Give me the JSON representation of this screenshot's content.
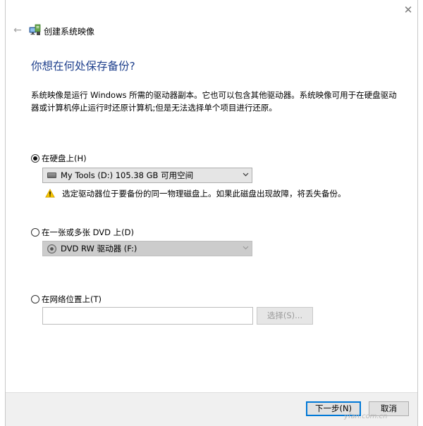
{
  "window": {
    "title": "创建系统映像",
    "close_glyph": "✕",
    "back_glyph": "←"
  },
  "heading": "你想在何处保存备份?",
  "description": "系统映像是运行 Windows 所需的驱动器副本。它也可以包含其他驱动器。系统映像可用于在硬盘驱动器或计算机停止运行时还原计算机;但是无法选择单个项目进行还原。",
  "options": {
    "hard_disk": {
      "label": "在硬盘上(H)",
      "selected": true,
      "dropdown_value": "My Tools (D:)  105.38 GB 可用空间",
      "warning": "选定驱动器位于要备份的同一物理磁盘上。如果此磁盘出现故障，将丢失备份。"
    },
    "dvd": {
      "label": "在一张或多张 DVD 上(D)",
      "selected": false,
      "dropdown_value": "DVD RW 驱动器 (F:)"
    },
    "network": {
      "label": "在网络位置上(T)",
      "selected": false,
      "path_value": "",
      "browse_label": "选择(S)..."
    }
  },
  "footer": {
    "next_label": "下一步(N)",
    "cancel_label": "取消"
  },
  "watermark": "yfan.com.cn",
  "colors": {
    "heading": "#1e3f8c",
    "default_button_border": "#0078d7",
    "footer_bg": "#f0f0f0",
    "warning_yellow": "#f5c400"
  },
  "icons": {
    "app": "system-backup-icon",
    "warning": "warning-icon",
    "hard_drive": "hard-drive-icon",
    "dvd": "dvd-drive-icon"
  }
}
